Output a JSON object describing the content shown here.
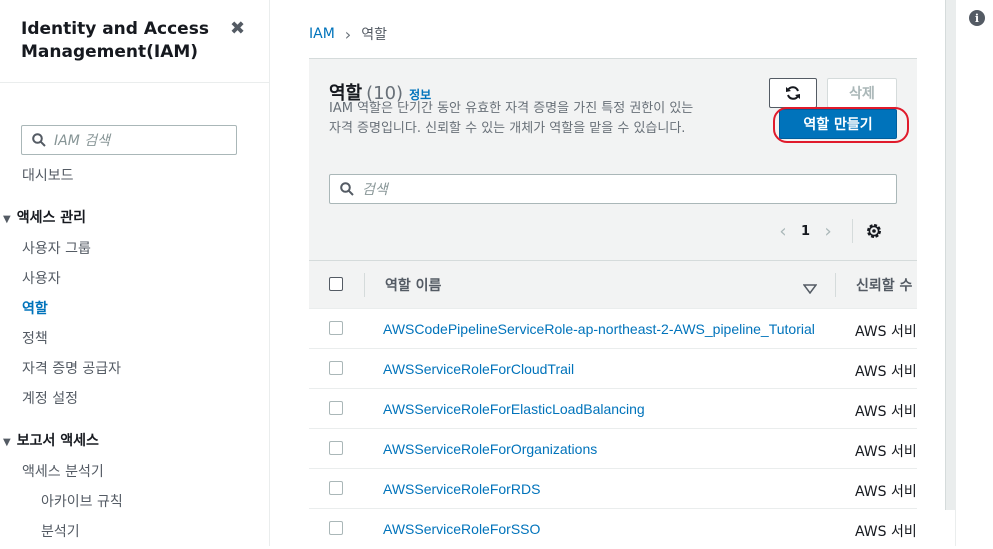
{
  "sidebar": {
    "title": "Identity and Access Management(IAM)",
    "search_placeholder": "IAM 검색",
    "items": [
      {
        "label": "대시보드"
      },
      {
        "label": "액세스 관리",
        "group": true
      },
      {
        "label": "사용자 그룹"
      },
      {
        "label": "사용자"
      },
      {
        "label": "역할",
        "active": true
      },
      {
        "label": "정책"
      },
      {
        "label": "자격 증명 공급자"
      },
      {
        "label": "계정 설정"
      },
      {
        "label": "보고서 액세스",
        "group": true
      },
      {
        "label": "액세스 분석기"
      },
      {
        "label": "아카이브 규칙",
        "sub": true
      },
      {
        "label": "분석기",
        "sub": true
      }
    ]
  },
  "breadcrumb": {
    "root": "IAM",
    "current": "역할"
  },
  "panel": {
    "title": "역할",
    "count": "(10)",
    "info": "정보",
    "description": "IAM 역할은 단기간 동안 유효한 자격 증명을 가진 특정 권한이 있는 자격 증명입니다. 신뢰할 수 있는 개체가 역할을 맡을 수 있습니다.",
    "delete_label": "삭제",
    "create_label": "역할 만들기",
    "search_placeholder": "검색",
    "page": "1"
  },
  "table": {
    "col_name": "역할 이름",
    "col_trust": "신뢰할 수",
    "rows": [
      {
        "name": "AWSCodePipelineServiceRole-ap-northeast-2-AWS_pipeline_Tutorial",
        "trust": "AWS 서비"
      },
      {
        "name": "AWSServiceRoleForCloudTrail",
        "trust": "AWS 서비"
      },
      {
        "name": "AWSServiceRoleForElasticLoadBalancing",
        "trust": "AWS 서비"
      },
      {
        "name": "AWSServiceRoleForOrganizations",
        "trust": "AWS 서비"
      },
      {
        "name": "AWSServiceRoleForRDS",
        "trust": "AWS 서비"
      },
      {
        "name": "AWSServiceRoleForSSO",
        "trust": "AWS 서비"
      }
    ]
  },
  "colors": {
    "accent": "#0073bb",
    "highlight": "#e01a2b"
  }
}
